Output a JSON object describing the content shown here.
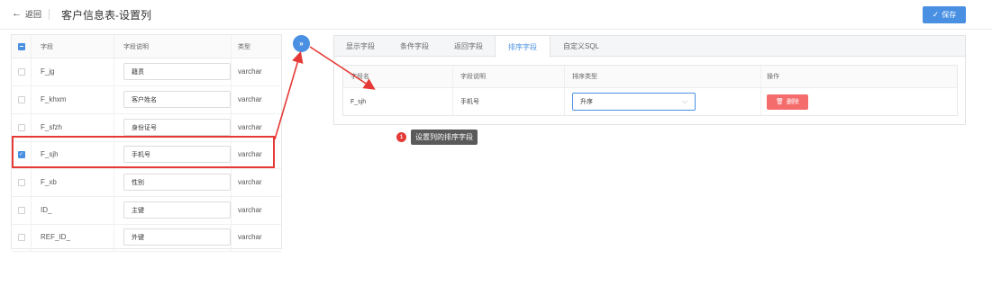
{
  "header": {
    "back_label": "返回",
    "title": "客户信息表-设置列",
    "save_label": "保存"
  },
  "field_table": {
    "columns": {
      "field": "字段",
      "desc": "字段说明",
      "type": "类型"
    },
    "rows": [
      {
        "field": "F_jg",
        "desc": "籍贯",
        "type": "varchar",
        "checked": false
      },
      {
        "field": "F_khxm",
        "desc": "客户姓名",
        "type": "varchar",
        "checked": false
      },
      {
        "field": "F_sfzh",
        "desc": "身份证号",
        "type": "varchar",
        "checked": false
      },
      {
        "field": "F_sjh",
        "desc": "手机号",
        "type": "varchar",
        "checked": true
      },
      {
        "field": "F_xb",
        "desc": "性别",
        "type": "varchar",
        "checked": false
      },
      {
        "field": "ID_",
        "desc": "主键",
        "type": "varchar",
        "checked": false
      },
      {
        "field": "REF_ID_",
        "desc": "外键",
        "type": "varchar",
        "checked": false
      }
    ]
  },
  "move_button_label": "»",
  "tabs": [
    {
      "label": "显示字段",
      "active": false
    },
    {
      "label": "条件字段",
      "active": false
    },
    {
      "label": "返回字段",
      "active": false
    },
    {
      "label": "排序字段",
      "active": true
    },
    {
      "label": "自定义SQL",
      "active": false
    }
  ],
  "sort_table": {
    "columns": {
      "name": "字段名",
      "desc": "字段说明",
      "sort_type": "排序类型",
      "action": "操作"
    },
    "rows": [
      {
        "name": "F_sjh",
        "desc": "手机号",
        "sort_type": "升序",
        "delete_label": "删除"
      }
    ]
  },
  "callout": {
    "number": "1",
    "text": "设置列的排序字段"
  },
  "colors": {
    "primary": "#4a90e2",
    "danger": "#f56c6c",
    "highlight": "#e53935",
    "tooltip": "#5a5a5a"
  }
}
